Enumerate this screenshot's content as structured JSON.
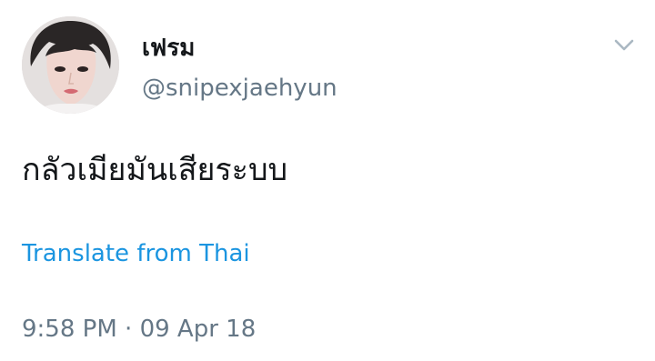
{
  "user": {
    "display_name": "เฟรม",
    "handle": "@snipexjaehyun",
    "avatar_icon": "profile-photo"
  },
  "tweet": {
    "text": "กลัวเมียมันเสียระบบ",
    "translate_label": "Translate from Thai",
    "time": "9:58 PM",
    "separator": "·",
    "date": "09 Apr 18"
  },
  "menu": {
    "icon": "chevron-down-icon"
  },
  "colors": {
    "text": "#14171a",
    "secondary": "#657786",
    "link": "#1b95e0"
  }
}
